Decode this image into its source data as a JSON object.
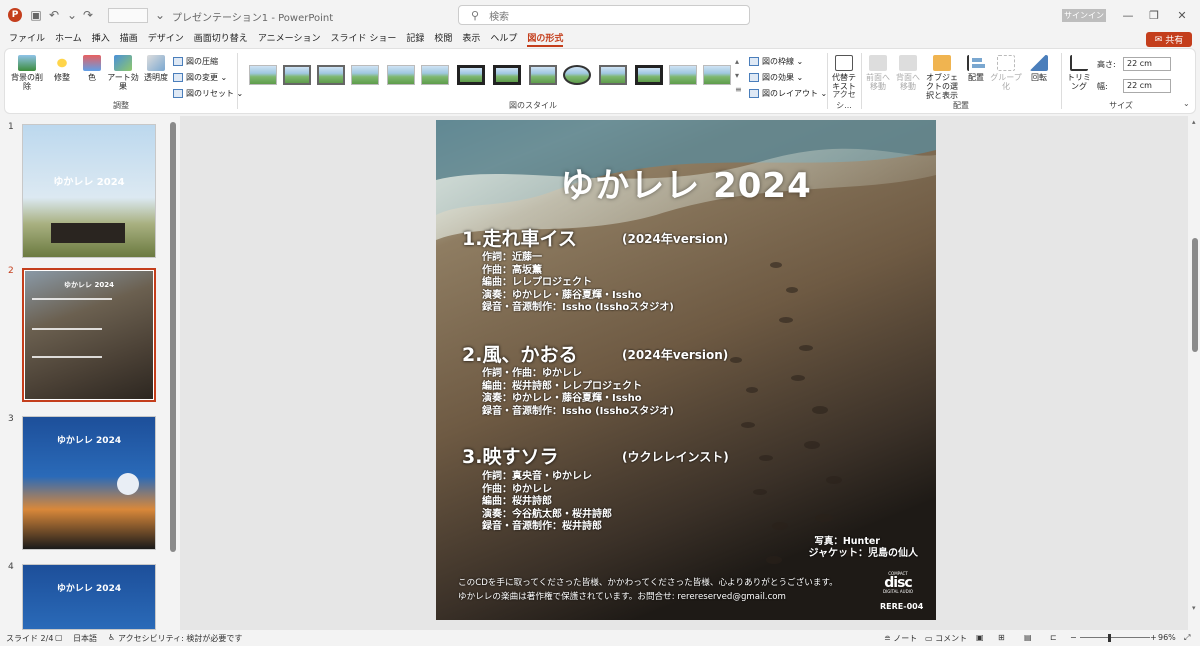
{
  "window": {
    "doc_title": "プレゼンテーション1 - PowerPoint",
    "search_placeholder": "検索",
    "signin": "サインイン",
    "share": "共有"
  },
  "menu": [
    "ファイル",
    "ホーム",
    "挿入",
    "描画",
    "デザイン",
    "画面切り替え",
    "アニメーション",
    "スライド ショー",
    "記録",
    "校閲",
    "表示",
    "ヘルプ",
    "図の形式"
  ],
  "ribbon": {
    "adjust": {
      "remove_bg": "背景の削除",
      "corrections": "修整",
      "color": "色",
      "art_effects": "アート効果",
      "transparency": "透明度",
      "compress": "図の圧縮",
      "change": "図の変更",
      "reset": "図のリセット",
      "label": "調整"
    },
    "styles": {
      "border": "図の枠線",
      "effects": "図の効果",
      "layout": "図のレイアウト",
      "label": "図のスタイル"
    },
    "accessibility": {
      "alt_text": "代替テキスト",
      "label": "アクセシ..."
    },
    "arrange": {
      "bring_forward": "前面へ移動",
      "send_backward": "背面へ移動",
      "selection_pane": "オブジェクトの選択と表示",
      "align": "配置",
      "group": "グループ化",
      "rotate": "回転",
      "label": "配置"
    },
    "size": {
      "crop": "トリミング",
      "height_label": "高さ:",
      "height": "22 cm",
      "width_label": "幅:",
      "width": "22 cm",
      "label": "サイズ"
    }
  },
  "thumbnails": [
    {
      "num": "1",
      "title": "ゆかレレ 2024"
    },
    {
      "num": "2",
      "title": "ゆかレレ 2024"
    },
    {
      "num": "3",
      "title": "ゆかレレ 2024"
    },
    {
      "num": "4",
      "title": "ゆかレレ 2024"
    }
  ],
  "slide": {
    "title": "ゆかレレ 2024",
    "songs": [
      {
        "name": "1.走れ車イス",
        "version": "(2024年version)",
        "credits": [
          "作詞：近藤一",
          "作曲：高坂薫",
          "編曲：レレプロジェクト",
          "演奏：ゆかレレ・藤谷夏輝・Issho",
          "録音・音源制作：Issho (Isshoスタジオ)"
        ]
      },
      {
        "name": "2.風、かおる",
        "version": "(2024年version)",
        "credits": [
          "作詞・作曲：ゆかレレ",
          "編曲：桜井詩郎・レレプロジェクト",
          "演奏：ゆかレレ・藤谷夏輝・Issho",
          "録音・音源制作：Issho (Isshoスタジオ)"
        ]
      },
      {
        "name": "3.映すソラ",
        "version": "(ウクレレインスト)",
        "credits": [
          "作詞：真央音・ゆかレレ",
          "作曲：ゆかレレ",
          "編曲：桜井詩郎",
          "演奏：今谷航太郎・桜井詩郎",
          "録音・音源制作：桜井詩郎"
        ]
      }
    ],
    "photo_credit": "写真：Hunter",
    "jacket_credit": "ジャケット：児島の仙人",
    "thanks": "このCDを手に取ってくださった皆様、かかわってくださった皆様、心よりありがとうございます。",
    "copyright": "ゆかレレの楽曲は著作権で保護されています。お問合せ: rerereserved@gmail.com",
    "disc_logo_top": "COMPACT",
    "disc_logo_main": "disc",
    "disc_logo_bottom": "DIGITAL AUDIO",
    "catalog": "RERE-004"
  },
  "status": {
    "slide": "スライド 2/4",
    "lang": "日本語",
    "accessibility": "アクセシビリティ: 検討が必要です",
    "notes": "ノート",
    "comments": "コメント",
    "zoom": "96%"
  }
}
